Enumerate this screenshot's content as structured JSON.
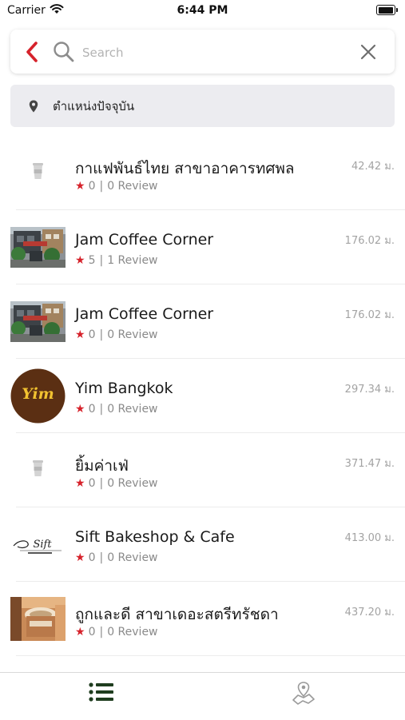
{
  "status_bar": {
    "carrier": "Carrier",
    "time": "6:44 PM"
  },
  "search": {
    "placeholder": "Search",
    "value": ""
  },
  "location": {
    "label": "ตำแหน่งปัจจุบัน"
  },
  "places": [
    {
      "name": "กาแฟพันธ์ไทย สาขาอาคารทศพล",
      "rating": "0",
      "reviews": "0 Review",
      "distance": "42.42 ม.",
      "thumb": "cup-icon"
    },
    {
      "name": "Jam Coffee Corner",
      "rating": "5",
      "reviews": "1 Review",
      "distance": "176.02 ม.",
      "thumb": "storefront-photo"
    },
    {
      "name": "Jam Coffee Corner",
      "rating": "0",
      "reviews": "0 Review",
      "distance": "176.02 ม.",
      "thumb": "storefront-photo"
    },
    {
      "name": "Yim Bangkok",
      "rating": "0",
      "reviews": "0 Review",
      "distance": "297.34 ม.",
      "thumb": "yim-logo",
      "logo_text": "Yim"
    },
    {
      "name": "ยิ้มค่าเฟ่",
      "rating": "0",
      "reviews": "0 Review",
      "distance": "371.47 ม.",
      "thumb": "cup-icon"
    },
    {
      "name": "Sift Bakeshop & Cafe",
      "rating": "0",
      "reviews": "0 Review",
      "distance": "413.00 ม.",
      "thumb": "sift-logo",
      "logo_text": "Sift"
    },
    {
      "name": "ถูกและดี สาขาเดอะสตรีทรัชดา",
      "rating": "0",
      "reviews": "0 Review",
      "distance": "437.20 ม.",
      "thumb": "coffee-photo"
    }
  ],
  "tabs": [
    {
      "name": "list",
      "icon": "list-icon",
      "active": true
    },
    {
      "name": "map",
      "icon": "map-pin-icon",
      "active": false
    }
  ],
  "colors": {
    "accent_red": "#d6222b",
    "tab_active": "#1f3d1f",
    "tab_inactive": "#9a9a9a"
  }
}
